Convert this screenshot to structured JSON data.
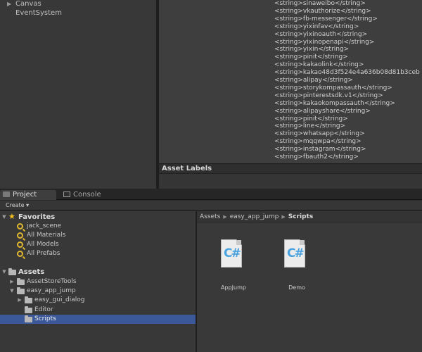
{
  "hierarchy": {
    "items": [
      {
        "label": "Canvas",
        "expandable": true
      },
      {
        "label": "EventSystem",
        "expandable": false
      }
    ]
  },
  "inspector": {
    "code_lines": [
      "<string>sinaweibo</string>",
      "<string>vkauthorize</string>",
      "<string>fb-messenger</string>",
      "<string>yixinfav</string>",
      "<string>yixinoauth</string>",
      "<string>yixinopenapi</string>",
      "<string>yixin</string>",
      "<string>pinit</string>",
      "<string>kakaolink</string>",
      "<string>kakao48d3f524e4a636b08d81b3ceb",
      "<string>alipay</string>",
      "<string>storykompassauth</string>",
      "<string>pinterestsdk.v1</string>",
      "<string>kakaokompassauth</string>",
      "<string>alipayshare</string>",
      "<string>pinit</string>",
      "<string>line</string>",
      "<string>whatsapp</string>",
      "<string>mqqwpa</string>",
      "<string>instagram</string>",
      "<string>fbauth2</string>"
    ],
    "asset_labels_title": "Asset Labels"
  },
  "tabs": [
    {
      "label": "Project",
      "active": true
    },
    {
      "label": "Console",
      "active": false
    }
  ],
  "toolbar": {
    "create_label": "Create ▾"
  },
  "project_tree": {
    "favorites": {
      "label": "Favorites",
      "items": [
        "jack_scene",
        "All Materials",
        "All Models",
        "All Prefabs"
      ]
    },
    "assets": {
      "label": "Assets",
      "items": [
        {
          "label": "AssetStoreTools",
          "depth": 1,
          "expandable": true,
          "expanded": false,
          "selected": false
        },
        {
          "label": "easy_app_jump",
          "depth": 1,
          "expandable": true,
          "expanded": true,
          "selected": false
        },
        {
          "label": "easy_gui_dialog",
          "depth": 2,
          "expandable": true,
          "expanded": false,
          "selected": false
        },
        {
          "label": "Editor",
          "depth": 2,
          "expandable": false,
          "expanded": false,
          "selected": false
        },
        {
          "label": "Scripts",
          "depth": 2,
          "expandable": false,
          "expanded": false,
          "selected": true
        }
      ]
    }
  },
  "browser": {
    "breadcrumb": [
      "Assets",
      "easy_app_jump",
      "Scripts"
    ],
    "assets": [
      {
        "name": "AppJump",
        "type": "C# script",
        "glyph": "C#"
      },
      {
        "name": "Demo",
        "type": "C# script",
        "glyph": "C#"
      }
    ]
  },
  "colors": {
    "selection": "#3b5998",
    "csharp_glyph": "#4aa3df",
    "favorite_star": "#f0c020",
    "search_icon": "#e0b830"
  }
}
